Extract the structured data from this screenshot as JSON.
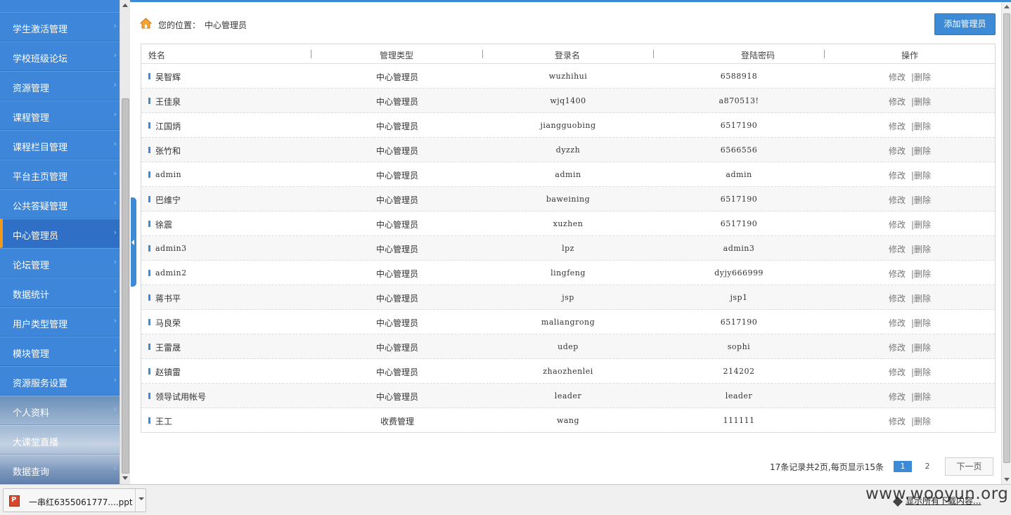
{
  "sidebar": {
    "items": [
      {
        "label": "学生激活管理",
        "active": false
      },
      {
        "label": "学校班级论坛",
        "active": false
      },
      {
        "label": "资源管理",
        "active": false
      },
      {
        "label": "课程管理",
        "active": false
      },
      {
        "label": "课程栏目管理",
        "active": false
      },
      {
        "label": "平台主页管理",
        "active": false
      },
      {
        "label": "公共答疑管理",
        "active": false
      },
      {
        "label": "中心管理员",
        "active": true
      },
      {
        "label": "论坛管理",
        "active": false
      },
      {
        "label": "数据统计",
        "active": false
      },
      {
        "label": "用户类型管理",
        "active": false
      },
      {
        "label": "模块管理",
        "active": false
      },
      {
        "label": "资源服务设置",
        "active": false
      },
      {
        "label": "个人资料",
        "active": false
      },
      {
        "label": "大课堂直播",
        "active": false
      },
      {
        "label": "数据查询",
        "active": false
      }
    ]
  },
  "breadcrumb": {
    "prefix": "您的位置：",
    "current": "中心管理员"
  },
  "toolbar": {
    "add_label": "添加管理员"
  },
  "table": {
    "headers": [
      "姓名",
      "管理类型",
      "登录名",
      "登陆密码",
      "操作"
    ],
    "rows": [
      {
        "name": "吴智辉",
        "type": "中心管理员",
        "login": "wuzhihui",
        "password": "6588918"
      },
      {
        "name": "王佳泉",
        "type": "中心管理员",
        "login": "wjq1400",
        "password": "a870513!"
      },
      {
        "name": "江国炳",
        "type": "中心管理员",
        "login": "jiangguobing",
        "password": "6517190"
      },
      {
        "name": "张竹和",
        "type": "中心管理员",
        "login": "dyzzh",
        "password": "6566556"
      },
      {
        "name": "admin",
        "type": "中心管理员",
        "login": "admin",
        "password": "admin"
      },
      {
        "name": "巴维宁",
        "type": "中心管理员",
        "login": "baweining",
        "password": "6517190"
      },
      {
        "name": "徐震",
        "type": "中心管理员",
        "login": "xuzhen",
        "password": "6517190"
      },
      {
        "name": "admin3",
        "type": "中心管理员",
        "login": "lpz",
        "password": "admin3"
      },
      {
        "name": "admin2",
        "type": "中心管理员",
        "login": "lingfeng",
        "password": "dyjy666999"
      },
      {
        "name": "蒋书平",
        "type": "中心管理员",
        "login": "jsp",
        "password": "jsp1"
      },
      {
        "name": "马良荣",
        "type": "中心管理员",
        "login": "maliangrong",
        "password": "6517190"
      },
      {
        "name": "王雷晟",
        "type": "中心管理员",
        "login": "udep",
        "password": "sophi"
      },
      {
        "name": "赵镇雷",
        "type": "中心管理员",
        "login": "zhaozhenlei",
        "password": "214202"
      },
      {
        "name": "领导试用帐号",
        "type": "中心管理员",
        "login": "leader",
        "password": "leader"
      },
      {
        "name": "王工",
        "type": "收费管理",
        "login": "wang",
        "password": "111111"
      }
    ],
    "edit_label": "修改",
    "delete_label": "|删除"
  },
  "pagination": {
    "info": "17条记录共2页,每页显示15条",
    "pages": [
      "1",
      "2"
    ],
    "current": "1",
    "next_label": "下一页"
  },
  "download_bar": {
    "file_name": "一串红6355061777....ppt",
    "show_all_label": "显示所有下载内容...",
    "watermark": "www.wooyun.org"
  },
  "colors": {
    "accent": "#3d8ad6",
    "sidebar": "#3d86d9",
    "active_marker": "#f19a1b"
  }
}
